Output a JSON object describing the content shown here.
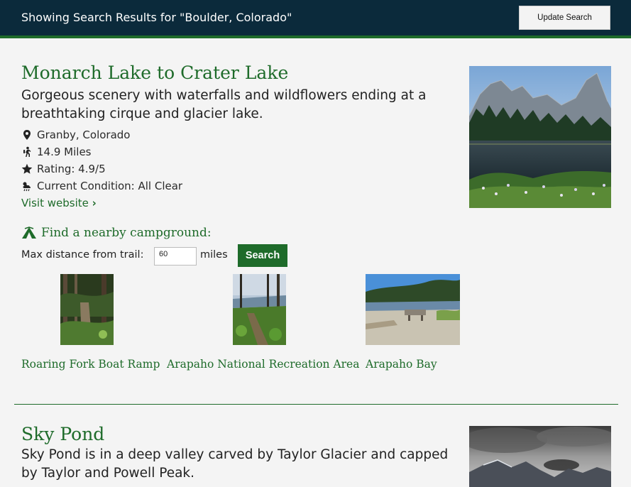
{
  "header": {
    "title": "Showing Search Results for \"Boulder, Colorado\"",
    "update_button": "Update Search"
  },
  "trails": [
    {
      "name": "Monarch Lake to Crater Lake",
      "description": "Gorgeous scenery with waterfalls and wildflowers ending at a breathtaking cirque and glacier lake.",
      "location": "Granby, Colorado",
      "distance": "14.9 Miles",
      "rating": "Rating: 4.9/5",
      "condition": "Current Condition: All Clear",
      "visit_link": "Visit website",
      "campground": {
        "heading": "Find a nearby campground:",
        "max_distance_label": "Max distance from trail:",
        "distance_value": "60",
        "units": "miles",
        "search_button": "Search",
        "results": [
          {
            "name": "Roaring Fork Boat Ramp"
          },
          {
            "name": "Arapaho National Recreation Area"
          },
          {
            "name": "Arapaho Bay"
          }
        ]
      }
    },
    {
      "name": "Sky Pond",
      "description": "Sky Pond is in a deep valley carved by Taylor Glacier and capped by Taylor and Powell Peak."
    }
  ],
  "colors": {
    "header_bg": "#0b2a3b",
    "accent_green": "#1e6b2a"
  }
}
